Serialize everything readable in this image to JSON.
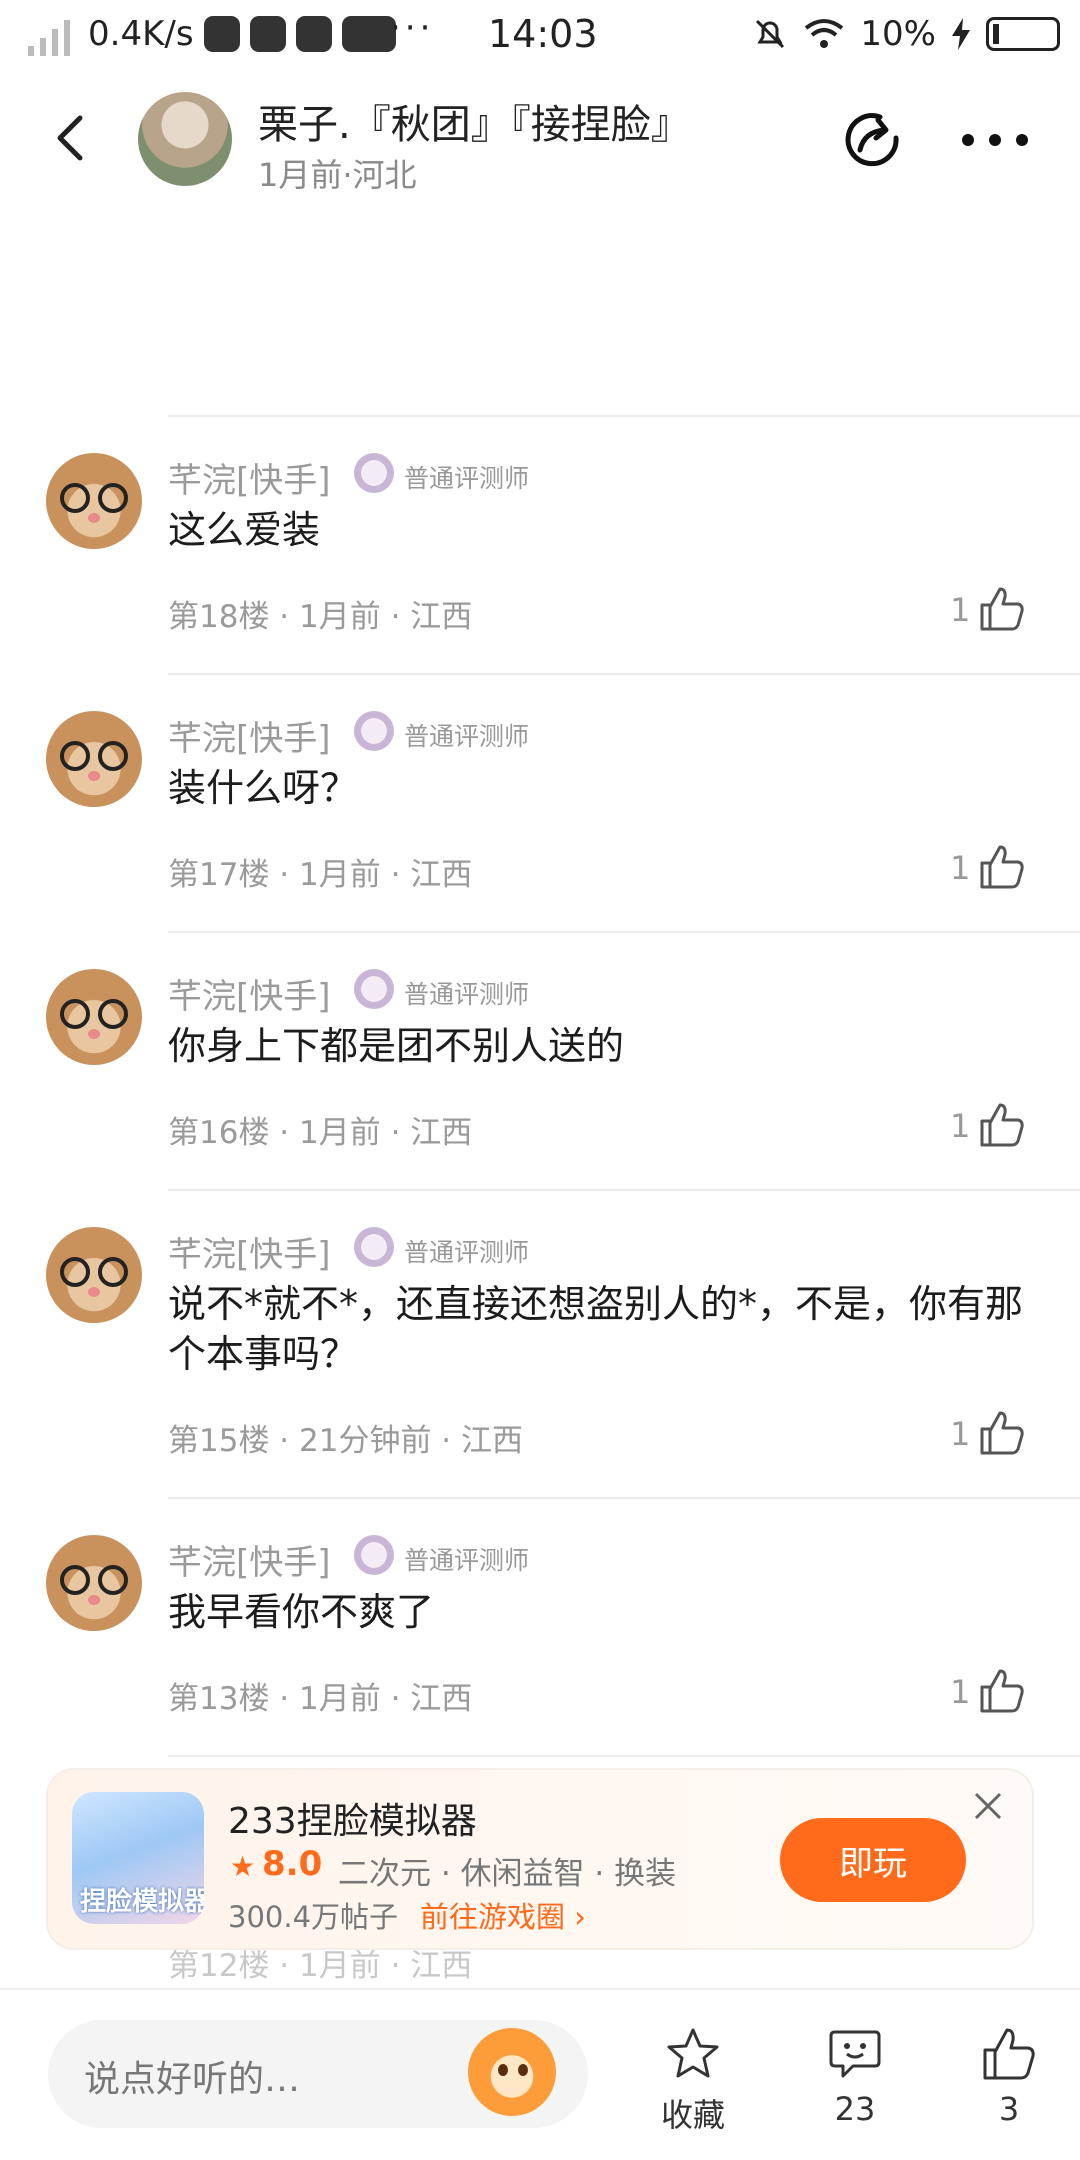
{
  "status_bar": {
    "speed": "0.4K/s",
    "dots": "···",
    "time": "14:03",
    "battery": "10%"
  },
  "header": {
    "owner_name": "栗子.『秋团』『接捏脸』",
    "owner_meta": "1月前·河北"
  },
  "comments": [
    {
      "user": "芊浣[快手]",
      "badge": "普通评测师",
      "text": "这么爱装",
      "meta": "第18楼 · 1月前 · 江西",
      "likes": "1"
    },
    {
      "user": "芊浣[快手]",
      "badge": "普通评测师",
      "text": "装什么呀？",
      "meta": "第17楼 · 1月前 · 江西",
      "likes": "1"
    },
    {
      "user": "芊浣[快手]",
      "badge": "普通评测师",
      "text": "你身上下都是团不别人送的",
      "meta": "第16楼 · 1月前 · 江西",
      "likes": "1"
    },
    {
      "user": "芊浣[快手]",
      "badge": "普通评测师",
      "text": "说不*就不*，还直接还想盗别人的*，不是，你有那个本事吗？",
      "meta": "第15楼 · 21分钟前 · 江西",
      "likes": "1"
    },
    {
      "user": "芊浣[快手]",
      "badge": "普通评测师",
      "text": "我早看你不爽了",
      "meta": "第13楼 · 1月前 · 江西",
      "likes": "1"
    }
  ],
  "game_card": {
    "icon_text": "捏脸模拟器",
    "title": "233捏脸模拟器",
    "score": "8.0",
    "tags": "二次元 · 休闲益智 · 换装",
    "posts": "300.4万帖子",
    "link": "前往游戏圈 ›",
    "play_label": "即玩"
  },
  "hidden_meta": "第12楼 · 1月前 · 江西",
  "bottom_bar": {
    "input_placeholder": "说点好听的…",
    "favorite_label": "收藏",
    "comment_count": "23",
    "like_count": "3"
  }
}
